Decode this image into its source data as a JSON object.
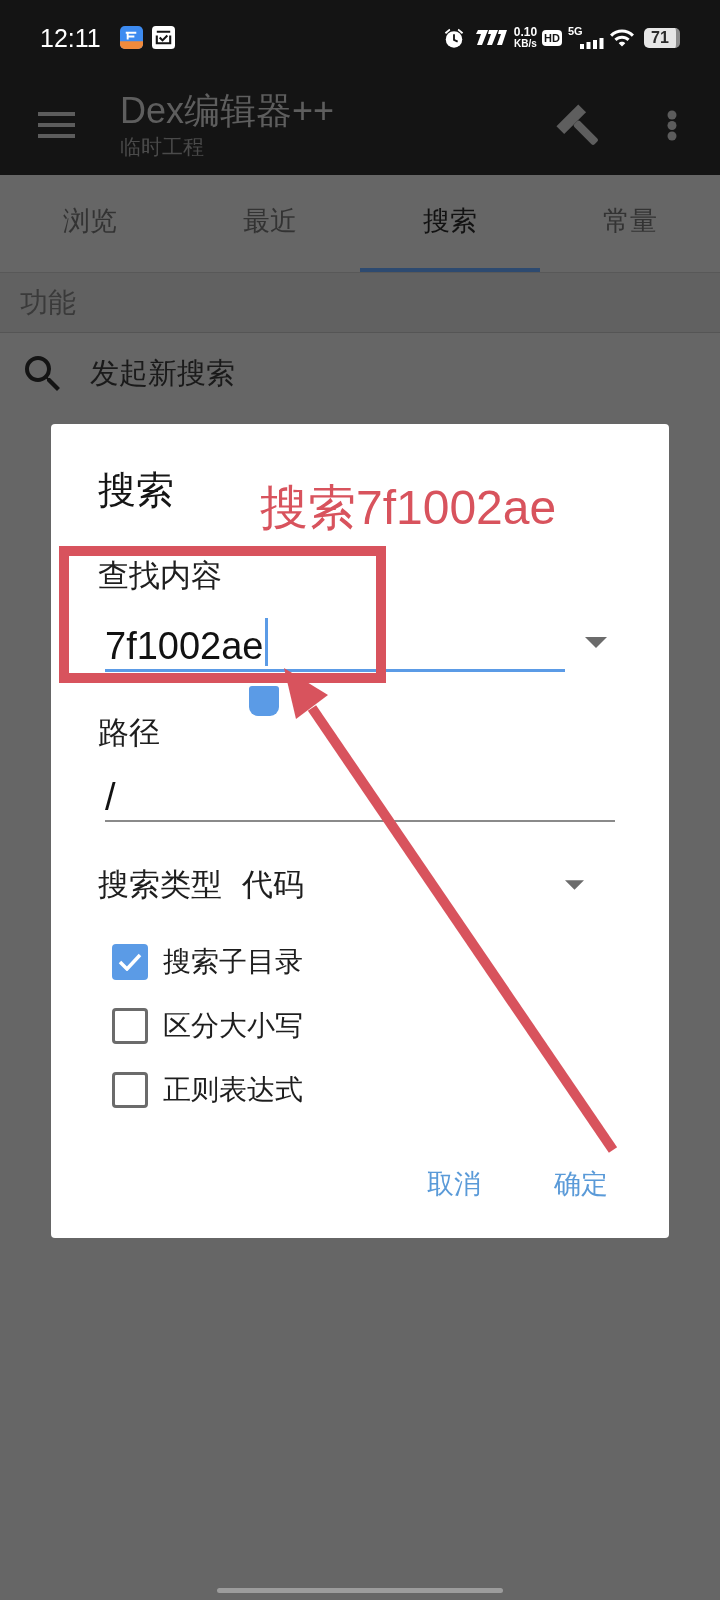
{
  "status_bar": {
    "time": "12:11",
    "net_speed": "0.10",
    "net_unit": "KB/s",
    "hd": "HD",
    "network": "5G",
    "battery": "71"
  },
  "app_bar": {
    "title": "Dex编辑器++",
    "subtitle": "临时工程"
  },
  "tabs": [
    {
      "label": "浏览",
      "selected": false
    },
    {
      "label": "最近",
      "selected": false
    },
    {
      "label": "搜索",
      "selected": true
    },
    {
      "label": "常量",
      "selected": false
    }
  ],
  "section": {
    "title": "功能"
  },
  "actions": [
    {
      "label": "发起新搜索"
    }
  ],
  "dialog": {
    "title": "搜索",
    "fields": [
      {
        "kind": "combo",
        "label": "查找内容",
        "value": "7f1002ae",
        "focused": true
      },
      {
        "kind": "text",
        "label": "路径",
        "value": "/",
        "focused": false
      }
    ],
    "search_type": {
      "label": "搜索类型",
      "value": "代码"
    },
    "options": [
      {
        "label": "搜索子目录",
        "checked": true
      },
      {
        "label": "区分大小写",
        "checked": false
      },
      {
        "label": "正则表达式",
        "checked": false
      }
    ],
    "buttons": [
      {
        "label": "取消"
      },
      {
        "label": "确定"
      }
    ]
  },
  "annotation": {
    "text": "搜索7f1002ae"
  }
}
